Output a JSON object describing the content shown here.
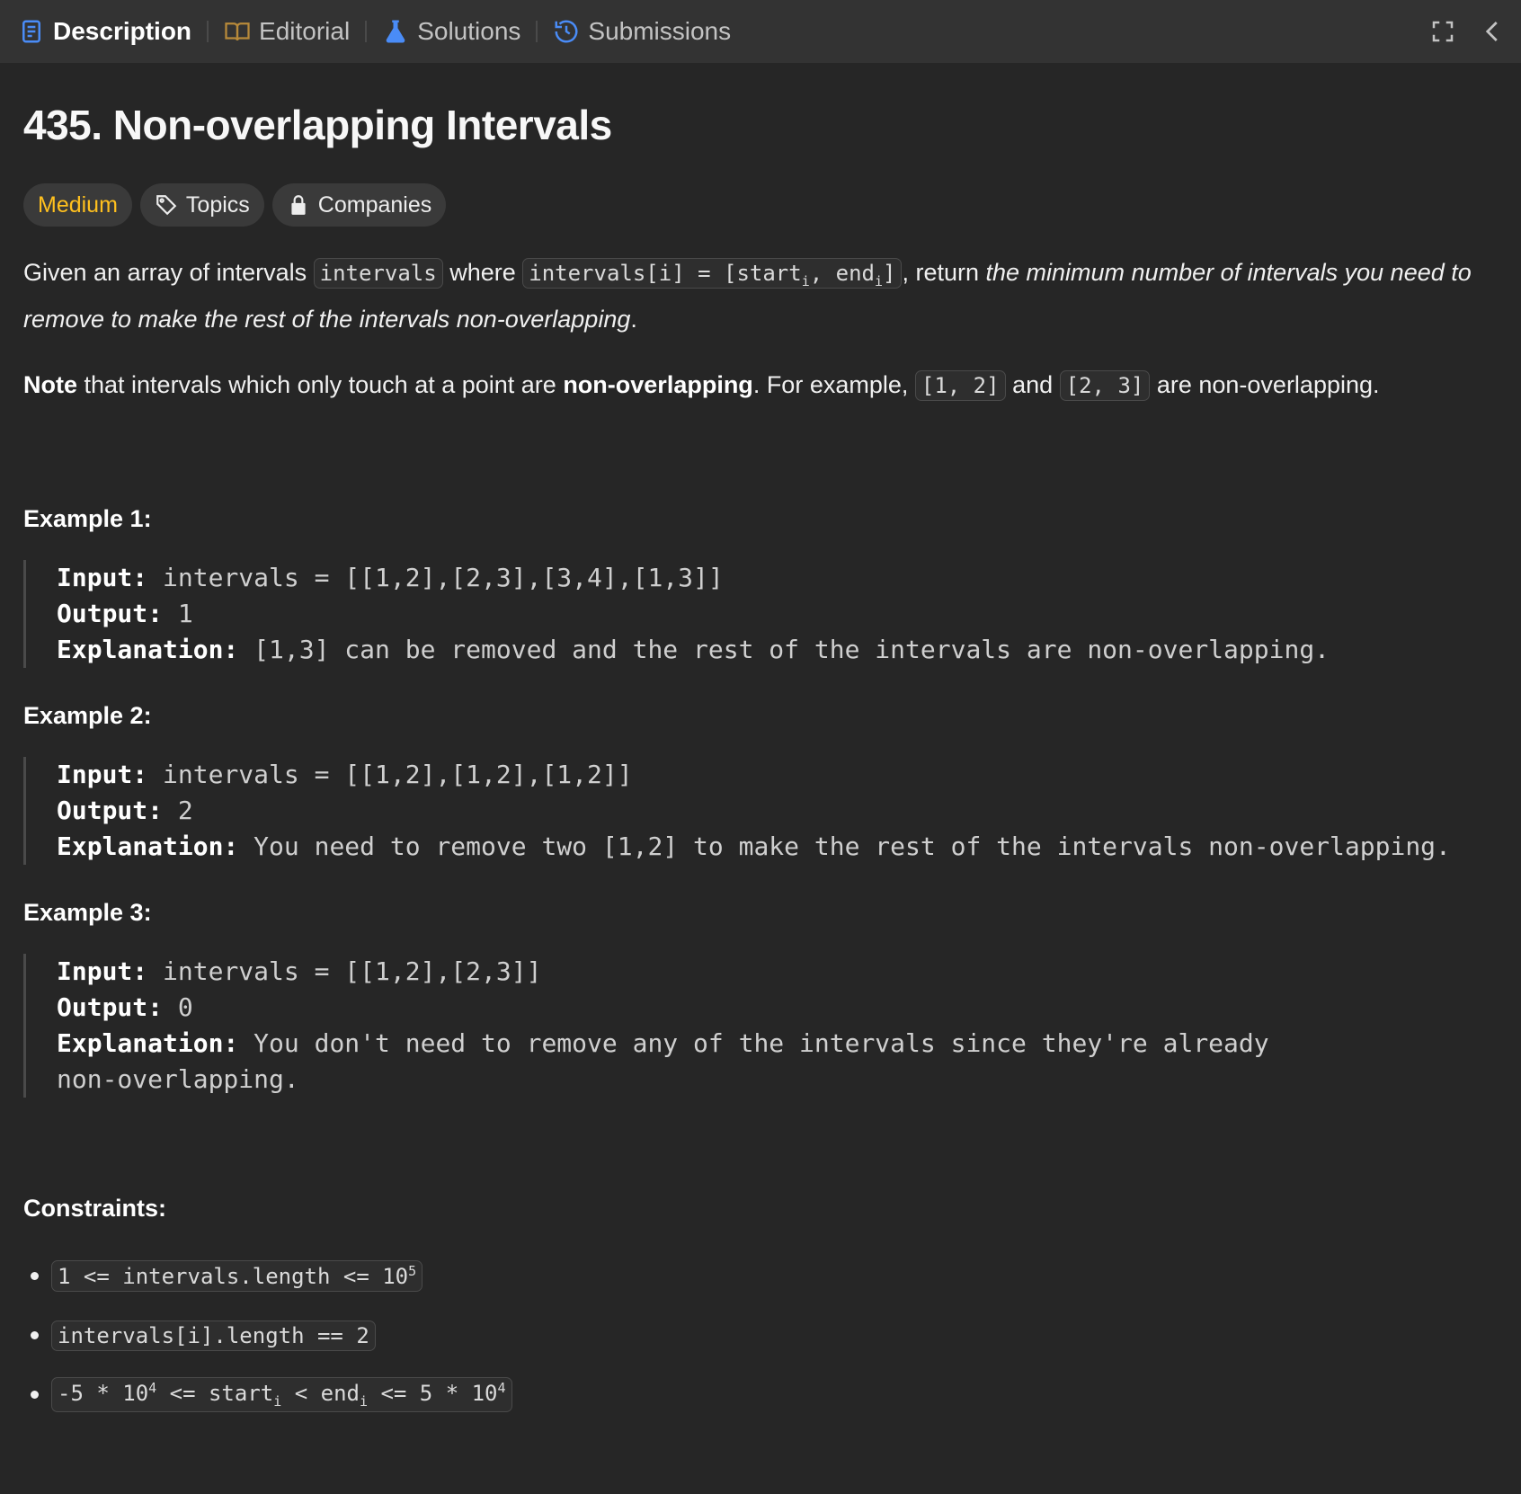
{
  "tabs": [
    {
      "label": "Description",
      "icon": "description-icon",
      "color": "#4a8cf7"
    },
    {
      "label": "Editorial",
      "icon": "book-icon",
      "color": "#b88a3a"
    },
    {
      "label": "Solutions",
      "icon": "flask-icon",
      "color": "#4a8cf7"
    },
    {
      "label": "Submissions",
      "icon": "history-icon",
      "color": "#4a8cf7"
    }
  ],
  "problem": {
    "title": "435. Non-overlapping Intervals",
    "difficulty": "Medium",
    "topics_label": "Topics",
    "companies_label": "Companies"
  },
  "description": {
    "p1_a": "Given an array of intervals ",
    "p1_code1": "intervals",
    "p1_b": " where ",
    "p1_code2_a": "intervals[i] = [start",
    "p1_code2_sub1": "i",
    "p1_code2_b": ", end",
    "p1_code2_sub2": "i",
    "p1_code2_c": "]",
    "p1_c": ", return ",
    "p1_em": "the minimum number of intervals you need to remove to make the rest of the intervals non-overlapping",
    "p1_d": ".",
    "p2_b1": "Note",
    "p2_a": " that intervals which only touch at a point are ",
    "p2_b2": "non-overlapping",
    "p2_c": ". For example, ",
    "p2_code1": "[1, 2]",
    "p2_d": " and ",
    "p2_code2": "[2, 3]",
    "p2_e": " are non-overlapping."
  },
  "examples": [
    {
      "title": "Example 1:",
      "input_label": "Input:",
      "input": " intervals = [[1,2],[2,3],[3,4],[1,3]]",
      "output_label": "Output:",
      "output": " 1",
      "explanation_label": "Explanation:",
      "explanation": " [1,3] can be removed and the rest of the intervals are non-overlapping."
    },
    {
      "title": "Example 2:",
      "input_label": "Input:",
      "input": " intervals = [[1,2],[1,2],[1,2]]",
      "output_label": "Output:",
      "output": " 2",
      "explanation_label": "Explanation:",
      "explanation": " You need to remove two [1,2] to make the rest of the intervals non-overlapping."
    },
    {
      "title": "Example 3:",
      "input_label": "Input:",
      "input": " intervals = [[1,2],[2,3]]",
      "output_label": "Output:",
      "output": " 0",
      "explanation_label": "Explanation:",
      "explanation": " You don't need to remove any of the intervals since they're already non-overlapping."
    }
  ],
  "constraints": {
    "title": "Constraints:",
    "c1_a": "1 <= intervals.length <= 10",
    "c1_sup": "5",
    "c2": "intervals[i].length == 2",
    "c3_a": "-5 * 10",
    "c3_sup1": "4",
    "c3_b": " <= start",
    "c3_sub1": "i",
    "c3_c": " < end",
    "c3_sub2": "i",
    "c3_d": " <= 5 * 10",
    "c3_sup2": "4"
  }
}
